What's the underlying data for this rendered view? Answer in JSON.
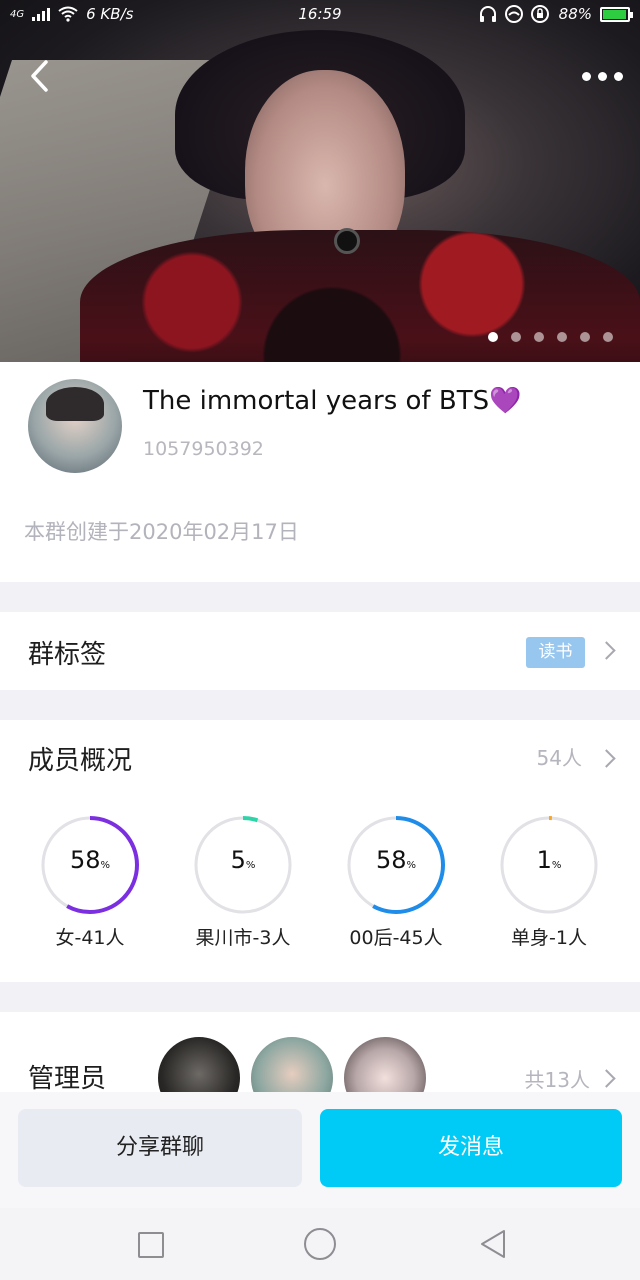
{
  "status_bar": {
    "network": "4G",
    "speed": "6 KB/s",
    "time": "16:59",
    "battery": "88%"
  },
  "header": {
    "photo_count": 6,
    "active_photo": 0
  },
  "group": {
    "name": "The immortal years of BTS💜",
    "id": "1057950392",
    "created": "本群创建于2020年02月17日"
  },
  "tags": {
    "title": "群标签",
    "chip": "读书"
  },
  "members": {
    "title": "成员概况",
    "count": "54人",
    "stats": [
      {
        "value": "58",
        "unit": "%",
        "fraction": 0.58,
        "label": "女-41人",
        "color": "#7b2fe0"
      },
      {
        "value": "5",
        "unit": "%",
        "fraction": 0.05,
        "label": "果川市-3人",
        "color": "#2fd3a8"
      },
      {
        "value": "58",
        "unit": "%",
        "fraction": 0.58,
        "label": "00后-45人",
        "color": "#1e8ce8"
      },
      {
        "value": "1",
        "unit": "%",
        "fraction": 0.01,
        "label": "单身-1人",
        "color": "#f5a623"
      }
    ]
  },
  "admins": {
    "title": "管理员",
    "count": "共13人"
  },
  "actions": {
    "share": "分享群聊",
    "send": "发消息"
  },
  "colors": {
    "primary": "#00cbf7",
    "tag_chip": "#97c6ee",
    "ring_track": "#e1e1e6"
  }
}
